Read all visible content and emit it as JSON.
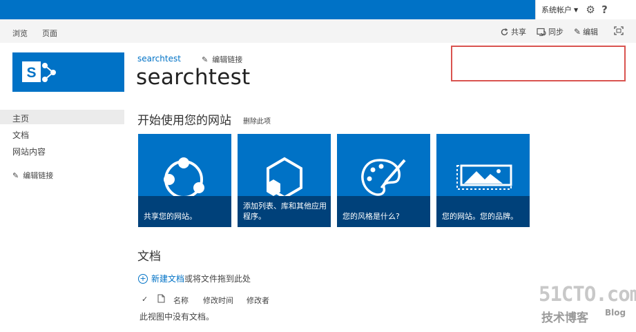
{
  "suite_bar": {
    "account_label": "系统帐户",
    "help_label": "?"
  },
  "ribbon": {
    "tabs": [
      "浏览",
      "页面"
    ],
    "actions": {
      "share": "共享",
      "sync": "同步",
      "edit": "编辑"
    }
  },
  "site": {
    "breadcrumb": "searchtest",
    "edit_links": "编辑链接",
    "title": "searchtest"
  },
  "left_nav": {
    "items": [
      "主页",
      "文档",
      "网站内容"
    ],
    "edit_links": "编辑链接"
  },
  "getting_started": {
    "title": "开始使用您的网站",
    "remove_label": "删除此项",
    "tiles": [
      {
        "label": "共享您的网站。",
        "icon": "share-icon"
      },
      {
        "label": "添加列表、库和其他应用程序。",
        "icon": "apps-icon"
      },
      {
        "label": "您的风格是什么?",
        "icon": "palette-icon"
      },
      {
        "label": "您的网站。您的品牌。",
        "icon": "picture-icon"
      }
    ]
  },
  "documents": {
    "title": "文档",
    "new_doc_link": "新建文档",
    "new_doc_rest": "或将文件拖到此处",
    "columns": [
      "名称",
      "修改时间",
      "修改者"
    ],
    "empty_message": "此视图中没有文档。"
  },
  "watermark": {
    "main": "51CTO.com",
    "sub": "技术博客",
    "blog": "Blog"
  },
  "colors": {
    "accent": "#0072c6",
    "tile_band": "#00417a",
    "highlight_box": "#d9534f"
  }
}
